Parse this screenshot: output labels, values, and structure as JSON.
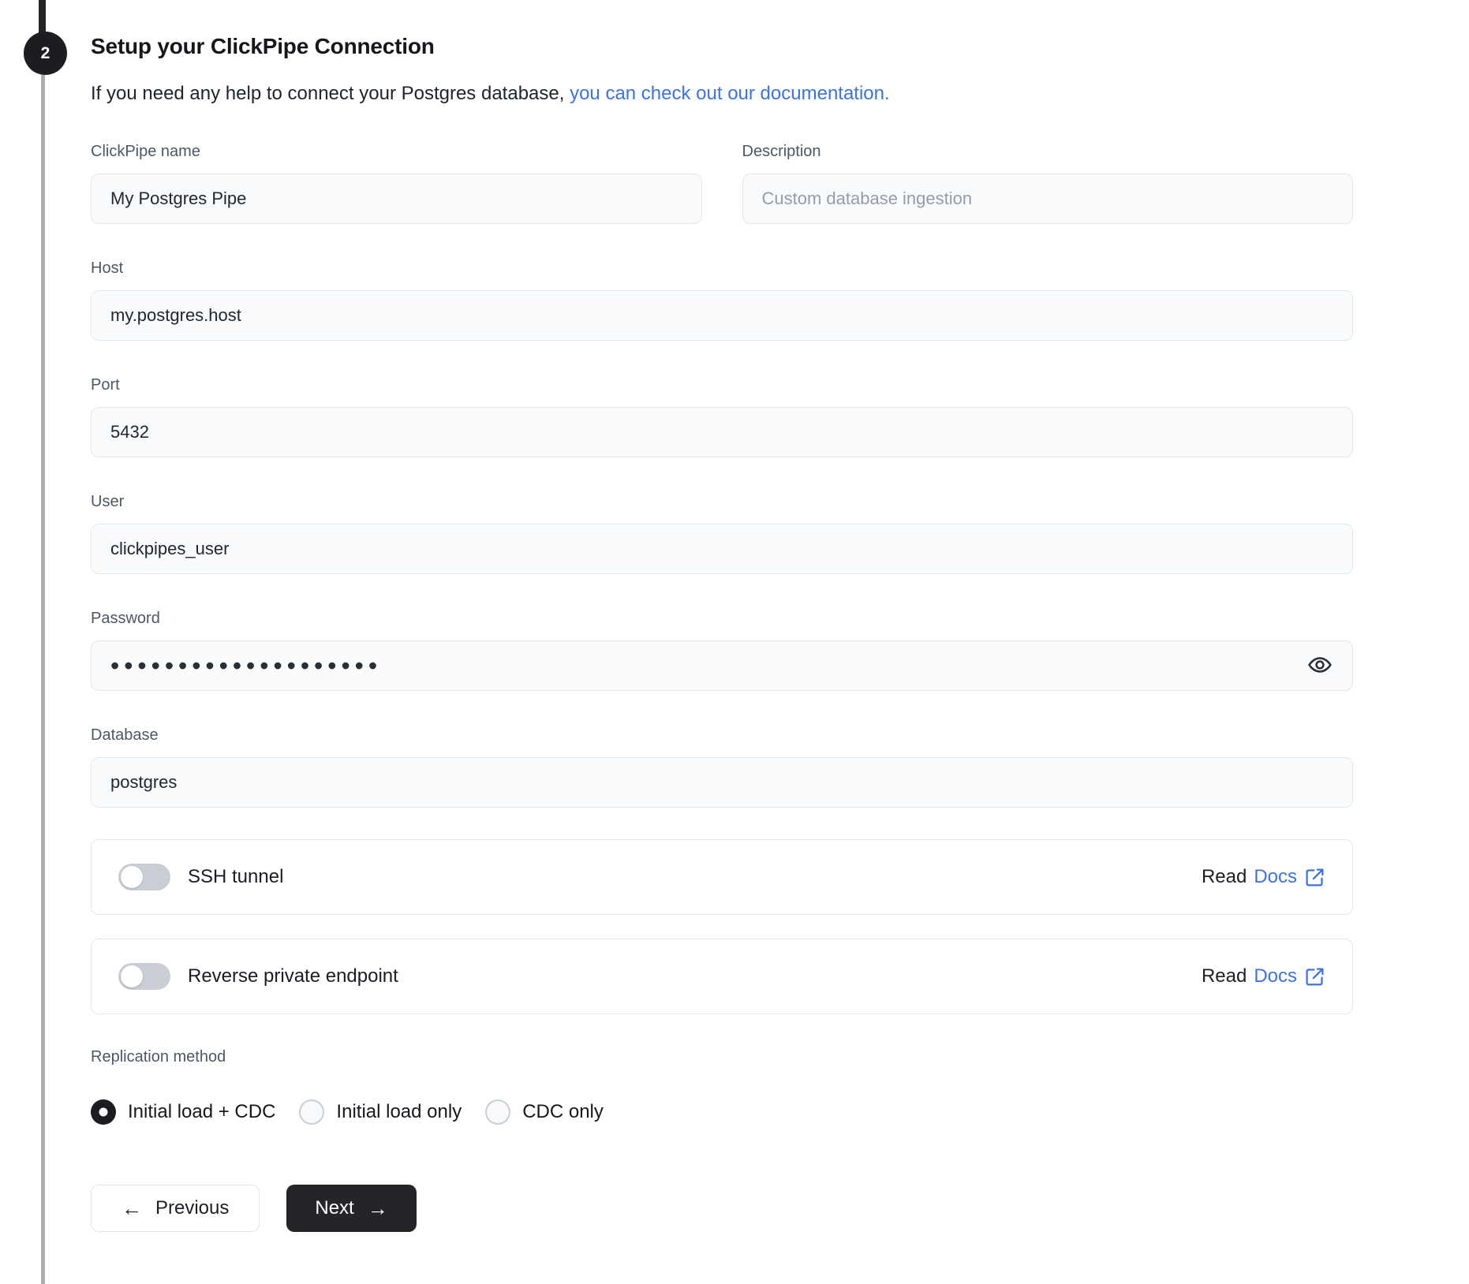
{
  "step": {
    "number": "2"
  },
  "header": {
    "title": "Setup your ClickPipe Connection",
    "help_text": "If you need any help to connect your Postgres database,",
    "help_link": "you can check out our documentation."
  },
  "form": {
    "clickpipe_name": {
      "label": "ClickPipe name",
      "value": "My Postgres Pipe"
    },
    "description": {
      "label": "Description",
      "placeholder": "Custom database ingestion"
    },
    "host": {
      "label": "Host",
      "value": "my.postgres.host"
    },
    "port": {
      "label": "Port",
      "value": "5432"
    },
    "user": {
      "label": "User",
      "value": "clickpipes_user"
    },
    "password": {
      "label": "Password",
      "value": "••••••••••••••••••••"
    },
    "database": {
      "label": "Database",
      "value": "postgres"
    }
  },
  "toggle_rows": [
    {
      "label": "SSH tunnel",
      "state": "off",
      "read_text": "Read",
      "docs_link": "Docs"
    },
    {
      "label": "Reverse private endpoint",
      "state": "off",
      "read_text": "Read",
      "docs_link": "Docs"
    }
  ],
  "replication": {
    "label": "Replication method",
    "options": [
      {
        "label": "Initial load + CDC",
        "selected": true
      },
      {
        "label": "Initial load only",
        "selected": false
      },
      {
        "label": "CDC only",
        "selected": false
      }
    ]
  },
  "buttons": {
    "previous": "Previous",
    "next": "Next"
  },
  "icons": {
    "arrow_left": "←",
    "arrow_right": "→"
  },
  "colors": {
    "accent_blue": "#3b74e1",
    "step_circle": "#1b1d20",
    "next_button": "#232528"
  }
}
